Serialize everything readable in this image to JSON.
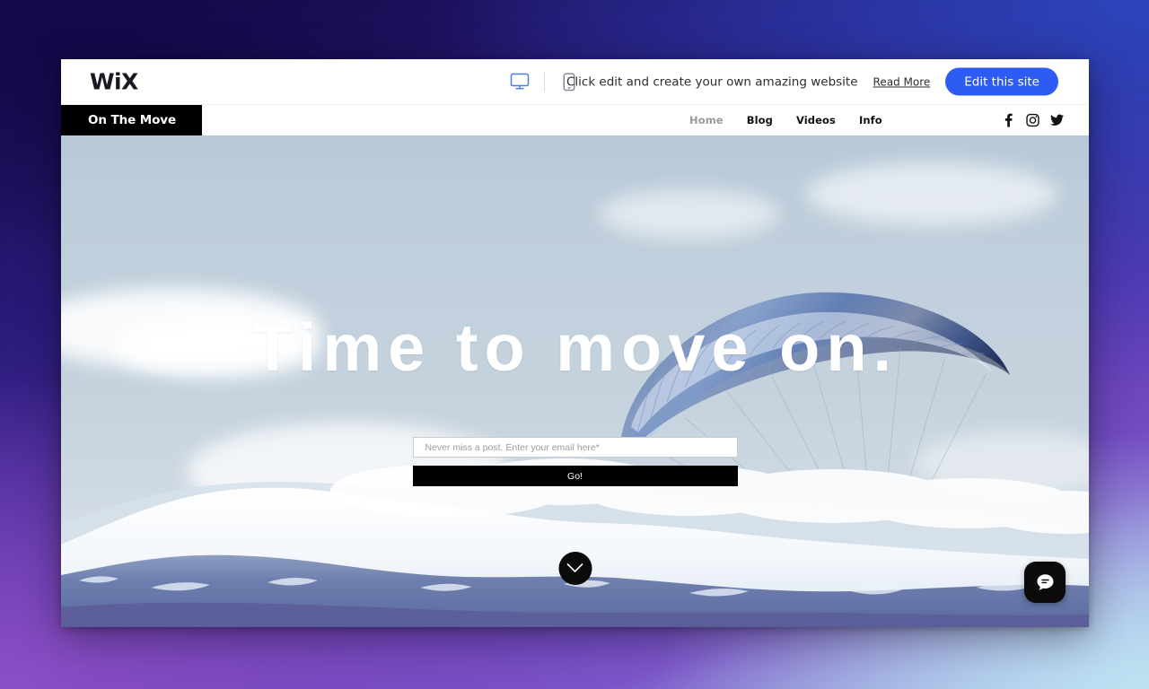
{
  "wallpaper": {
    "gradient_colors": [
      "#120a46",
      "#2a1a7a",
      "#2b44bb",
      "#8b4fc4",
      "#bfe0f2"
    ]
  },
  "wix_topbar": {
    "logo_text": "WiX",
    "viewport_desktop_icon": "desktop-monitor-icon",
    "viewport_mobile_icon": "mobile-phone-icon",
    "active_viewport": "desktop",
    "promo_text": "Click edit and create your own amazing website",
    "read_more_label": "Read More",
    "edit_site_label": "Edit this site",
    "accent_color": "#2f5bf5"
  },
  "site_header": {
    "site_title": "On The Move",
    "nav_items": [
      {
        "label": "Home",
        "active": true
      },
      {
        "label": "Blog",
        "active": false
      },
      {
        "label": "Videos",
        "active": false
      },
      {
        "label": "Info",
        "active": false
      }
    ],
    "social": [
      {
        "name": "facebook-icon",
        "label": "Facebook"
      },
      {
        "name": "instagram-icon",
        "label": "Instagram"
      },
      {
        "name": "twitter-icon",
        "label": "Twitter"
      }
    ]
  },
  "hero": {
    "title": "Time to move on.",
    "image_description": "paraglider over snow-capped mountains",
    "email_placeholder": "Never miss a post. Enter your email here*",
    "email_value": "",
    "go_label": "Go!",
    "scroll_icon": "chevron-down-icon",
    "chat_icon": "chat-bubble-icon"
  }
}
